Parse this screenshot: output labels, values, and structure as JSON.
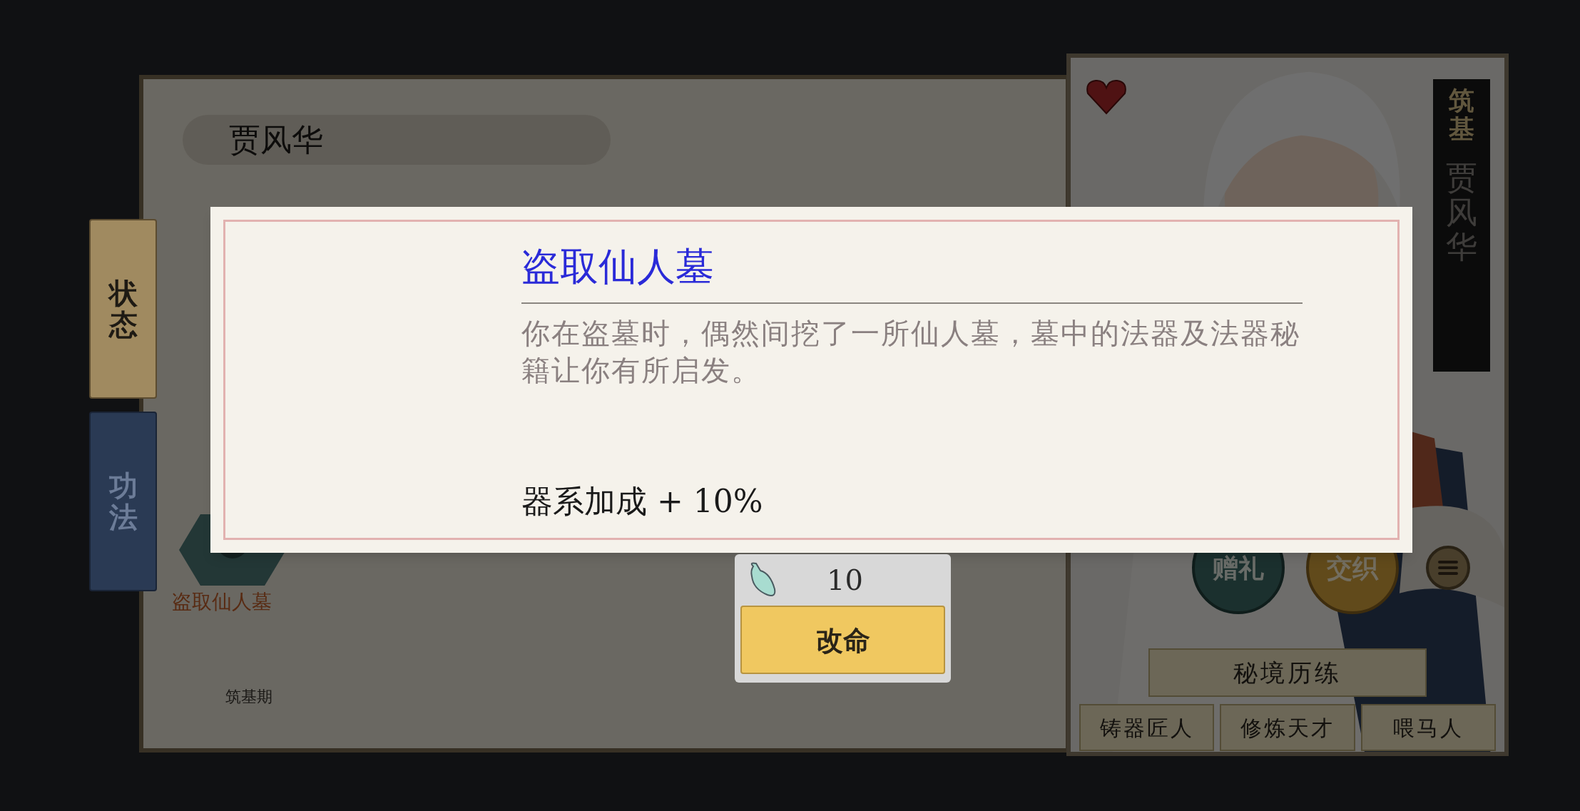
{
  "left_tabs": [
    {
      "label": "状态",
      "selected": true
    },
    {
      "label": "功法",
      "selected": false
    }
  ],
  "profile": {
    "name": "贾风华",
    "trait": {
      "label": "盗取仙人墓"
    },
    "stage": "筑基期"
  },
  "character_card": {
    "realm": "筑基",
    "name": "贾风华",
    "actions": [
      {
        "label": "赠礼",
        "kind": "gift"
      },
      {
        "label": "交织",
        "kind": "bond"
      }
    ],
    "mission": "秘境历练",
    "tags": [
      "铸器匠人",
      "修炼天才",
      "喂马人"
    ]
  },
  "dialog": {
    "title": "盗取仙人墓",
    "description": "你在盗墓时，偶然间挖了一所仙人墓，墓中的法器及法器秘籍让你有所启发。",
    "bonus": "器系加成 + 10%",
    "cost": "10",
    "confirm": "改命"
  }
}
